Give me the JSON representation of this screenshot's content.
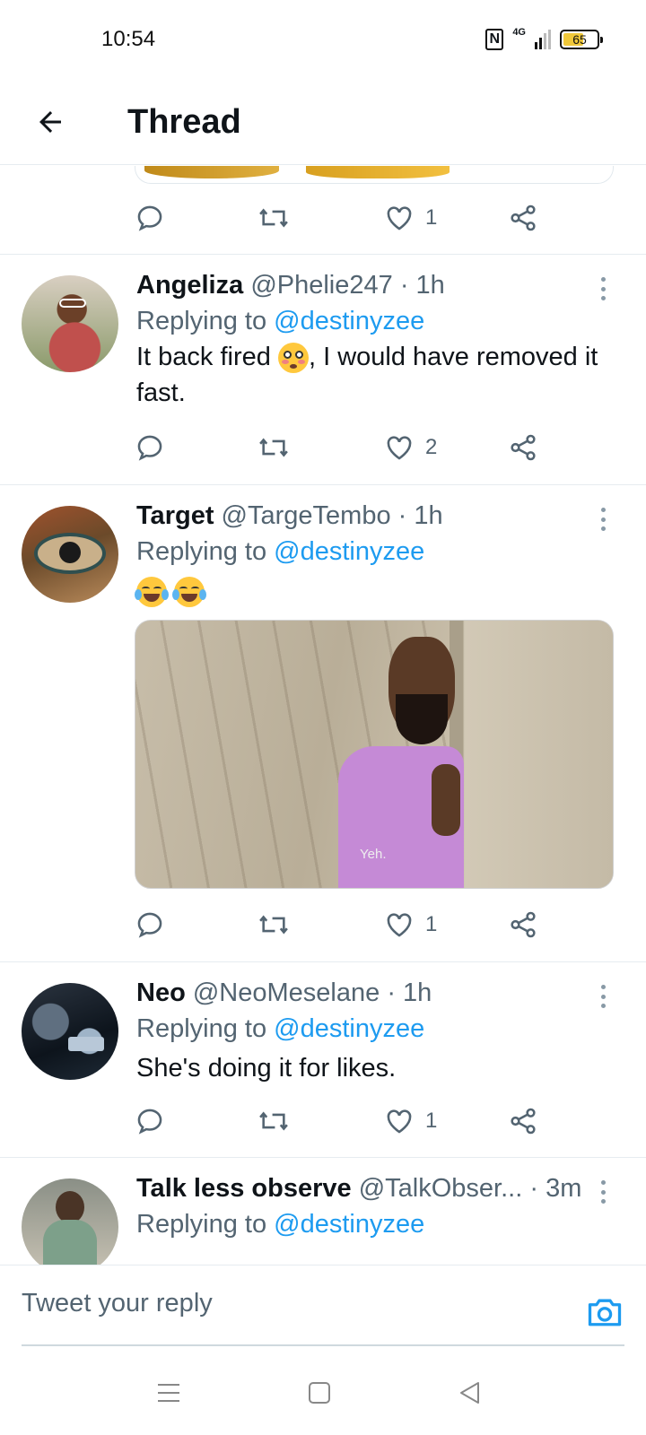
{
  "status_bar": {
    "time": "10:54",
    "network": "4G",
    "battery": "65"
  },
  "header": {
    "title": "Thread"
  },
  "prev_tweet": {
    "likes": "1"
  },
  "tweets": [
    {
      "name": "Angeliza",
      "handle": "@Phelie247",
      "time": "· 1h",
      "replying_prefix": "Replying to",
      "replying_to": "@destinyzee",
      "text_before": "It back fired",
      "text_after": ", I would have removed it",
      "text_line2": "fast.",
      "emoji": "flushed-face",
      "likes": "2"
    },
    {
      "name": "Target",
      "handle": "@TargeTembo",
      "time": "· 1h",
      "replying_prefix": "Replying to",
      "replying_to": "@destinyzee",
      "emoji": "face-with-tears-of-joy",
      "media_caption": "Yeh.",
      "likes": "1"
    },
    {
      "name": "Neo",
      "handle": "@NeoMeselane",
      "time": "· 1h",
      "replying_prefix": "Replying to",
      "replying_to": "@destinyzee",
      "text": "She's doing it for likes.",
      "likes": "1"
    },
    {
      "name": "Talk less observe",
      "handle": "@TalkObser...",
      "time": "· 3m",
      "replying_prefix": "Replying to",
      "replying_to": "@destinyzee"
    }
  ],
  "compose": {
    "placeholder": "Tweet your reply"
  },
  "colors": {
    "accent": "#1d9bf0",
    "muted": "#536471",
    "text": "#0f1419"
  }
}
